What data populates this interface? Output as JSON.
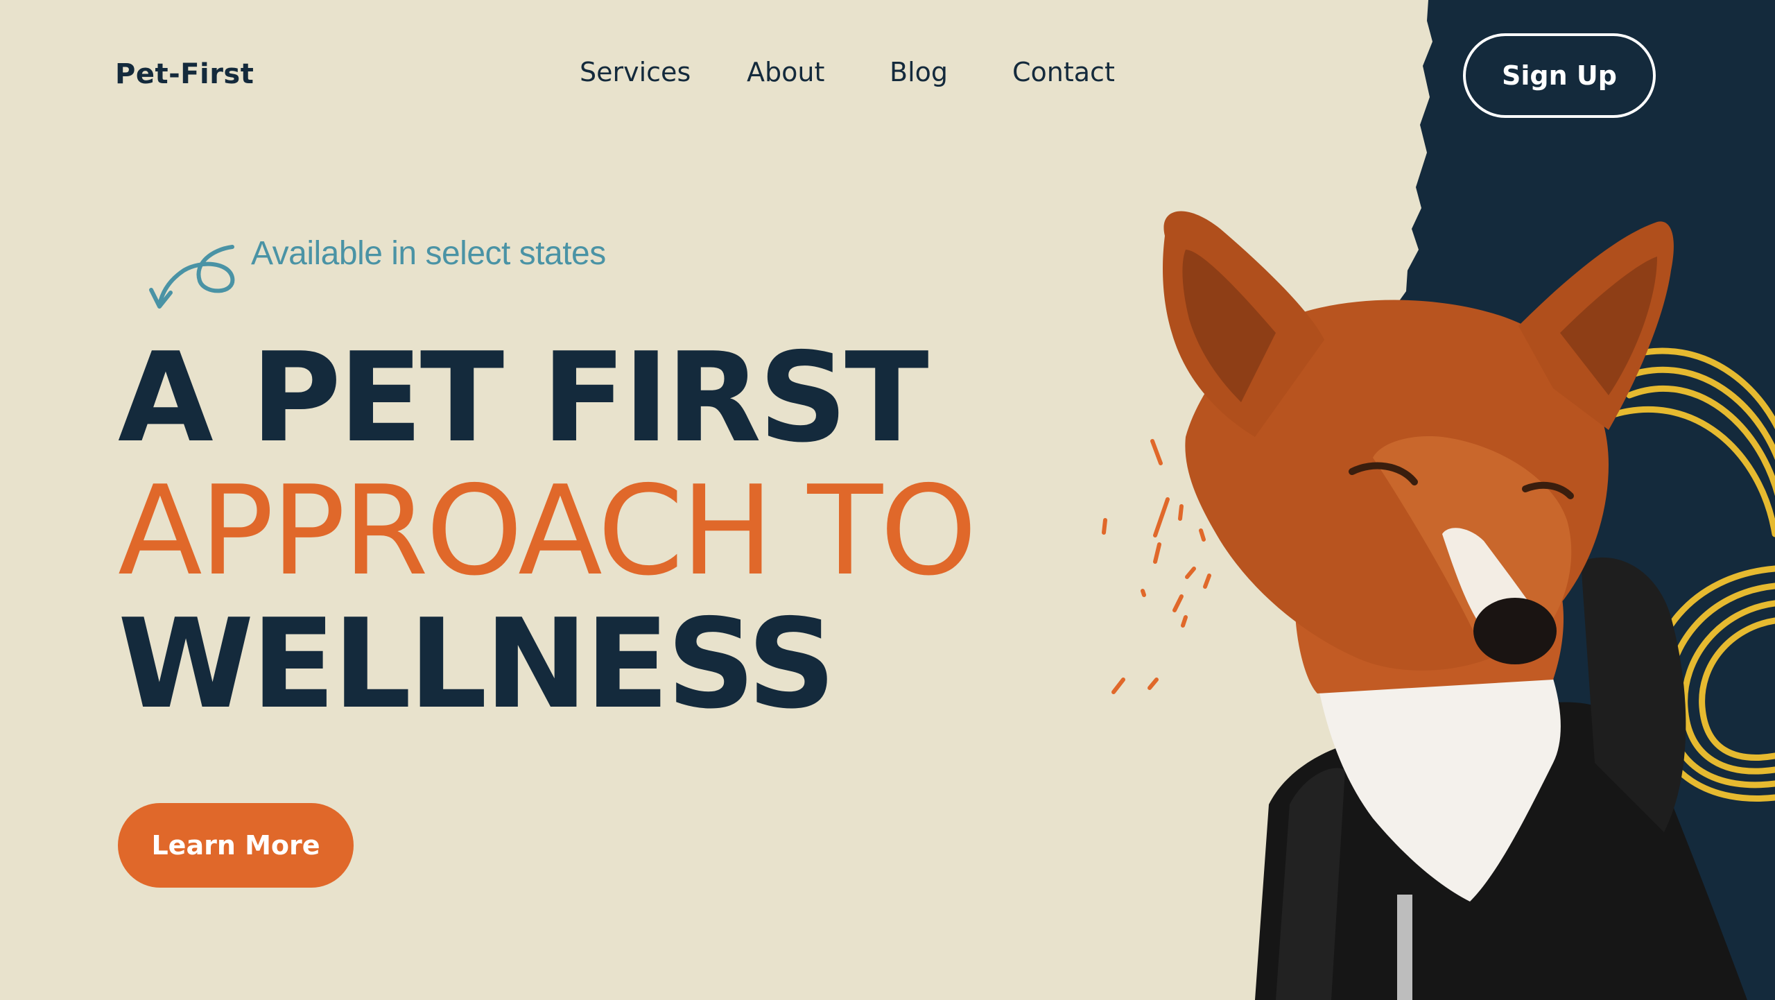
{
  "header": {
    "logo": "Pet-First",
    "nav": [
      {
        "label": "Services"
      },
      {
        "label": "About"
      },
      {
        "label": "Blog"
      },
      {
        "label": "Contact"
      }
    ],
    "signup_label": "Sign Up"
  },
  "hero": {
    "tagline": "Available in select states",
    "headline_line1": "A PET FIRST",
    "headline_line2": "APPROACH TO",
    "headline_line3": "WELLNESS",
    "cta_label": "Learn More",
    "image": "dog-in-black-hoodie"
  },
  "colors": {
    "background": "#e8e2cc",
    "navy": "#142a3c",
    "orange": "#e0682a",
    "teal": "#4a93a5",
    "yellow": "#f2c230"
  }
}
